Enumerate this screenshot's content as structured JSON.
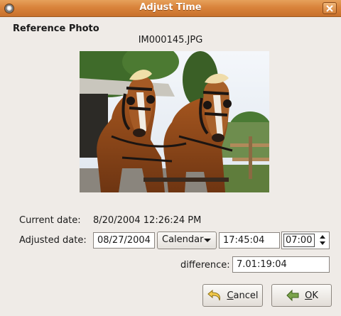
{
  "window": {
    "title": "Adjust Time"
  },
  "reference": {
    "heading": "Reference Photo",
    "filename": "IM000145.JPG"
  },
  "form": {
    "current_label": "Current date:",
    "current_value": "8/20/2004 12:26:24 PM",
    "adjusted_label": "Adjusted date:",
    "adjusted_date": "08/27/2004",
    "calendar_label": "Calendar",
    "adjusted_time": "17:45:04",
    "offset_value": "07:00",
    "difference_label": "difference:",
    "difference_value": "7.01:19:04"
  },
  "buttons": {
    "cancel_mnemonic": "C",
    "cancel_rest": "ancel",
    "ok_mnemonic": "O",
    "ok_rest": "K"
  }
}
